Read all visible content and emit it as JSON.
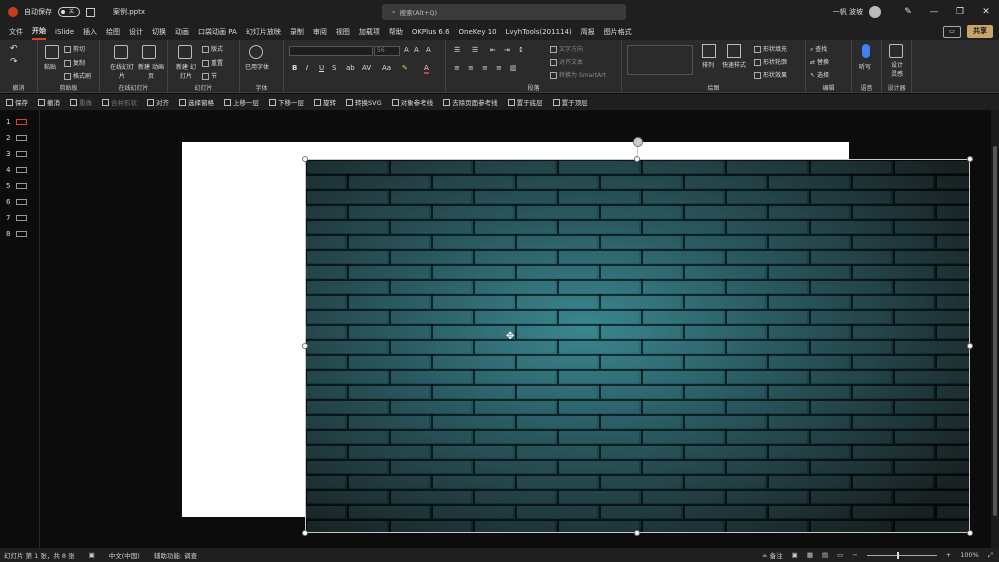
{
  "titlebar": {
    "autosave_label": "自动保存",
    "autosave_state": "关",
    "filename": "案例.pptx",
    "search_placeholder": "搜索(Alt+Q)",
    "user_name": "一帆 波坡"
  },
  "menu": {
    "tabs": [
      "文件",
      "开始",
      "iSlide",
      "插入",
      "绘图",
      "设计",
      "切换",
      "动画",
      "口袋动画 PA",
      "幻灯片放映",
      "录制",
      "审阅",
      "视图",
      "加载项",
      "帮助",
      "OKPlus 6.6",
      "OneKey 10",
      "LvyhTools(201114)",
      "简报",
      "图片格式"
    ],
    "active_tab": "开始",
    "share_label": "共享"
  },
  "ribbon": {
    "groups": {
      "undo": "撤消",
      "clipboard": "剪贴板",
      "online": "在线幻灯片",
      "slides": "幻灯片",
      "font": "字体",
      "paragraph": "段落",
      "drawing": "绘图",
      "editing": "编辑",
      "voice": "语音",
      "designer": "设计器"
    },
    "buttons": {
      "paste": "粘贴",
      "cut": "剪切",
      "copy": "复制",
      "format_painter": "格式刷",
      "online_slide": "在线幻灯片",
      "new_online": "新建 动画页",
      "new_slide": "新建 幻灯片",
      "layout": "版式",
      "reset": "重置",
      "section": "节",
      "font_used": "已用字体",
      "text_direction": "文字方向",
      "align_text": "对齐文本",
      "smartart": "转换为 SmartArt",
      "arrange": "排列",
      "quick_styles": "快速样式",
      "shape_fill": "形状填充",
      "shape_outline": "形状轮廓",
      "shape_effects": "形状效果",
      "find": "查找",
      "replace": "替换",
      "select": "选择",
      "dictate": "听写",
      "designer": "设计 灵感"
    },
    "font_size": "56"
  },
  "qat": {
    "items": [
      {
        "label": "保存",
        "enabled": true
      },
      {
        "label": "撤消",
        "enabled": true
      },
      {
        "label": "重做",
        "enabled": false
      },
      {
        "label": "合并形状",
        "enabled": false
      },
      {
        "label": "对齐",
        "enabled": true
      },
      {
        "label": "选择窗格",
        "enabled": true
      },
      {
        "label": "上移一层",
        "enabled": true
      },
      {
        "label": "下移一层",
        "enabled": true
      },
      {
        "label": "旋转",
        "enabled": true
      },
      {
        "label": "转换SVG",
        "enabled": true
      },
      {
        "label": "对象参考线",
        "enabled": true
      },
      {
        "label": "去除页面参考线",
        "enabled": true
      },
      {
        "label": "置于底层",
        "enabled": true
      },
      {
        "label": "置于顶层",
        "enabled": true
      }
    ]
  },
  "thumbnails": [
    "1",
    "2",
    "3",
    "4",
    "5",
    "6",
    "7",
    "8"
  ],
  "active_slide": "1",
  "status": {
    "slide_info": "幻灯片 第 1 张，共 8 张",
    "language": "中文(中国)",
    "accessibility": "辅助功能: 调查",
    "notes": "备注",
    "zoom": "100%"
  }
}
